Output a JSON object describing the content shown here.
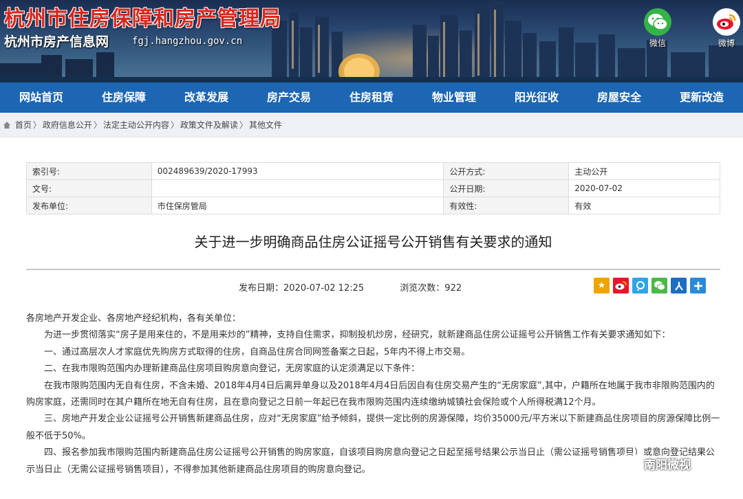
{
  "header": {
    "title": "杭州市住房保障和房产管理局",
    "subtitle": "杭州市房产信息网",
    "url": "fgj.hangzhou.gov.cn",
    "social": [
      {
        "label": "微信",
        "icon": "wechat-icon",
        "color": "#36b346"
      },
      {
        "label": "微博",
        "icon": "weibo-icon",
        "color": "#e6162d"
      }
    ]
  },
  "nav": {
    "items": [
      "网站首页",
      "住房保障",
      "改革发展",
      "房产交易",
      "住房租赁",
      "物业管理",
      "阳光征收",
      "房屋安全",
      "更新改造"
    ],
    "color": "#1c66b4"
  },
  "breadcrumb": [
    "首页",
    "政府信息公开",
    "法定主动公开内容",
    "政策文件及解读",
    "其他文件"
  ],
  "meta": {
    "rows": [
      {
        "k1": "索引号:",
        "v1": "002489639/2020-17993",
        "k2": "公开方式:",
        "v2": "主动公开"
      },
      {
        "k1": "文号:",
        "v1": "",
        "k2": "公开日期:",
        "v2": "2020-07-02"
      },
      {
        "k1": "发布单位:",
        "v1": "市住保房管局",
        "k2": "有效性:",
        "v2": "有效"
      }
    ]
  },
  "article": {
    "title": "关于进一步明确商品住房公证摇号公开销售有关要求的通知",
    "publish": "发布日期：2020-07-02 12:25",
    "views": "浏览次数：922",
    "paragraphs": [
      "各房地产开发企业、各房地产经纪机构，各有关单位：",
      "为进一步贯彻落实“房子是用来住的，不是用来炒的”精神，支持自住需求，抑制投机炒房，经研究，就新建商品住房公证摇号公开销售工作有关要求通知如下：",
      "一、通过高层次人才家庭优先购房方式取得的住房，自商品住房合同网签备案之日起，5年内不得上市交易。",
      "二、在我市限购范围内办理新建商品住房项目购房意向登记，无房家庭的认定须满足以下条件：",
      "在我市限购范围内无自有住房，不含未婚、2018年4月4日后离异单身以及2018年4月4日后因自有住房交易产生的“无房家庭”,其中，户籍所在地属于我市非限购范围内的购房家庭，还需同时在其户籍所在地无自有住房，且在意向登记之日前一年起已在我市限购范围内连续缴纳城镇社会保险或个人所得税满12个月。",
      "三、房地产开发企业公证摇号公开销售新建商品住房，应对“无房家庭”给予倾斜，提供一定比例的房源保障，均价35000元/平方米以下新建商品住房项目的房源保障比例一般不低于50%。",
      "四、报名参加我市限购范围内新建商品住房公证摇号公开销售的购房家庭，自该项目购房意向登记之日起至摇号结果公示当日止（需公证摇号销售项目）或意向登记结果公示当日止（无需公证摇号销售项目），不得参加其他新建商品住房项目的购房意向登记。"
    ]
  },
  "share_icons": [
    {
      "name": "favorite-star-icon",
      "color": "#f0a400"
    },
    {
      "name": "weibo-share-icon",
      "color": "#e6162d"
    },
    {
      "name": "tencent-weibo-icon",
      "color": "#2fa4e7"
    },
    {
      "name": "wechat-share-icon",
      "color": "#4cb848"
    },
    {
      "name": "renren-icon",
      "color": "#1b6ec2"
    },
    {
      "name": "more-share-icon",
      "color": "#2b8ad8"
    }
  ],
  "watermark": "南阳微视"
}
